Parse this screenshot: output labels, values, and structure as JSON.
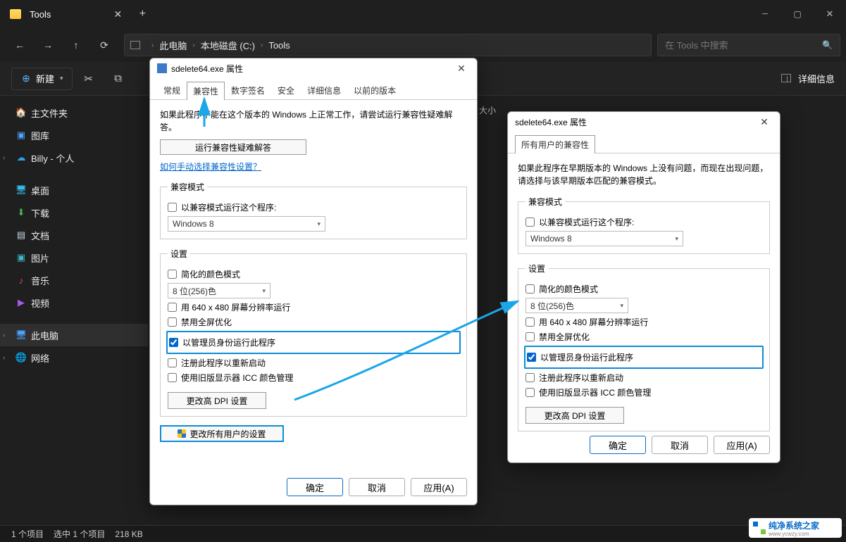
{
  "window": {
    "title": "Tools"
  },
  "breadcrumb": {
    "items": [
      "此电脑",
      "本地磁盘 (C:)",
      "Tools"
    ]
  },
  "search": {
    "placeholder": "在 Tools 中搜索"
  },
  "toolbar": {
    "new_label": "新建",
    "details_label": "详细信息"
  },
  "sidebar": {
    "items": [
      {
        "label": "主文件夹",
        "icon": "home"
      },
      {
        "label": "图库",
        "icon": "gallery"
      },
      {
        "label": "Billy - 个人",
        "icon": "cloud",
        "expandable": true
      },
      {
        "label": "桌面",
        "icon": "desktop"
      },
      {
        "label": "下载",
        "icon": "down"
      },
      {
        "label": "文档",
        "icon": "doc"
      },
      {
        "label": "图片",
        "icon": "pic"
      },
      {
        "label": "音乐",
        "icon": "music"
      },
      {
        "label": "视频",
        "icon": "video"
      },
      {
        "label": "此电脑",
        "icon": "pc",
        "expandable": true,
        "selected": true
      },
      {
        "label": "网络",
        "icon": "net",
        "expandable": true
      }
    ]
  },
  "content_header_hint": "大小",
  "statusbar": {
    "items_count": "1 个项目",
    "selected": "选中 1 个项目",
    "size": "218 KB"
  },
  "dialog1": {
    "title": "sdelete64.exe 属性",
    "tabs": [
      "常规",
      "兼容性",
      "数字签名",
      "安全",
      "详细信息",
      "以前的版本"
    ],
    "active_tab": 1,
    "intro": "如果此程序不能在这个版本的 Windows 上正常工作，请尝试运行兼容性疑难解答。",
    "troubleshoot_btn": "运行兼容性疑难解答",
    "help_link": "如何手动选择兼容性设置？",
    "compat_mode": {
      "legend": "兼容模式",
      "checkbox": "以兼容模式运行这个程序:",
      "value": "Windows 8"
    },
    "settings": {
      "legend": "设置",
      "reduced_color": "简化的颜色模式",
      "color_value": "8 位(256)色",
      "lowres": "用 640 x 480 屏幕分辨率运行",
      "disable_fullscreen": "禁用全屏优化",
      "run_as_admin": "以管理员身份运行此程序",
      "register_restart": "注册此程序以重新启动",
      "legacy_icc": "使用旧版显示器 ICC 颜色管理",
      "change_dpi": "更改高 DPI 设置"
    },
    "all_users_btn": "更改所有用户的设置",
    "actions": {
      "ok": "确定",
      "cancel": "取消",
      "apply": "应用(A)"
    }
  },
  "dialog2": {
    "title": "sdelete64.exe 属性",
    "tabs": [
      "所有用户的兼容性"
    ],
    "active_tab": 0,
    "intro": "如果此程序在早期版本的 Windows 上没有问题，而现在出现问题，请选择与该早期版本匹配的兼容模式。",
    "compat_mode": {
      "legend": "兼容模式",
      "checkbox": "以兼容模式运行这个程序:",
      "value": "Windows 8"
    },
    "settings": {
      "legend": "设置",
      "reduced_color": "简化的颜色模式",
      "color_value": "8 位(256)色",
      "lowres": "用 640 x 480 屏幕分辨率运行",
      "disable_fullscreen": "禁用全屏优化",
      "run_as_admin": "以管理员身份运行此程序",
      "register_restart": "注册此程序以重新启动",
      "legacy_icc": "使用旧版显示器 ICC 颜色管理",
      "change_dpi": "更改高 DPI 设置"
    },
    "actions": {
      "ok": "确定",
      "cancel": "取消",
      "apply": "应用(A)"
    }
  },
  "watermark": {
    "brand": "纯净系统之家",
    "url": "www.ycwzy.com"
  }
}
